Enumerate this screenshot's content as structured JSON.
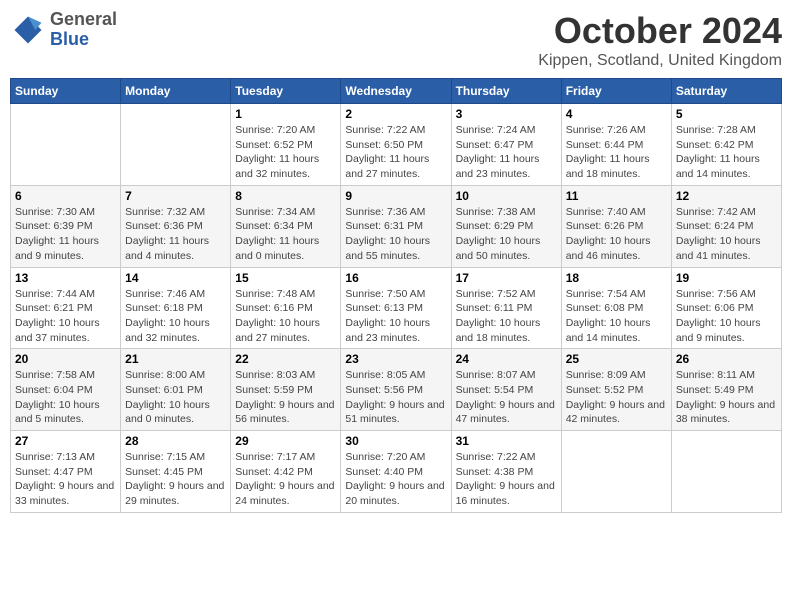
{
  "header": {
    "logo": {
      "general": "General",
      "blue": "Blue"
    },
    "title": "October 2024",
    "location": "Kippen, Scotland, United Kingdom"
  },
  "days_of_week": [
    "Sunday",
    "Monday",
    "Tuesday",
    "Wednesday",
    "Thursday",
    "Friday",
    "Saturday"
  ],
  "weeks": [
    [
      null,
      null,
      {
        "day": "1",
        "sunrise": "Sunrise: 7:20 AM",
        "sunset": "Sunset: 6:52 PM",
        "daylight": "Daylight: 11 hours and 32 minutes."
      },
      {
        "day": "2",
        "sunrise": "Sunrise: 7:22 AM",
        "sunset": "Sunset: 6:50 PM",
        "daylight": "Daylight: 11 hours and 27 minutes."
      },
      {
        "day": "3",
        "sunrise": "Sunrise: 7:24 AM",
        "sunset": "Sunset: 6:47 PM",
        "daylight": "Daylight: 11 hours and 23 minutes."
      },
      {
        "day": "4",
        "sunrise": "Sunrise: 7:26 AM",
        "sunset": "Sunset: 6:44 PM",
        "daylight": "Daylight: 11 hours and 18 minutes."
      },
      {
        "day": "5",
        "sunrise": "Sunrise: 7:28 AM",
        "sunset": "Sunset: 6:42 PM",
        "daylight": "Daylight: 11 hours and 14 minutes."
      }
    ],
    [
      {
        "day": "6",
        "sunrise": "Sunrise: 7:30 AM",
        "sunset": "Sunset: 6:39 PM",
        "daylight": "Daylight: 11 hours and 9 minutes."
      },
      {
        "day": "7",
        "sunrise": "Sunrise: 7:32 AM",
        "sunset": "Sunset: 6:36 PM",
        "daylight": "Daylight: 11 hours and 4 minutes."
      },
      {
        "day": "8",
        "sunrise": "Sunrise: 7:34 AM",
        "sunset": "Sunset: 6:34 PM",
        "daylight": "Daylight: 11 hours and 0 minutes."
      },
      {
        "day": "9",
        "sunrise": "Sunrise: 7:36 AM",
        "sunset": "Sunset: 6:31 PM",
        "daylight": "Daylight: 10 hours and 55 minutes."
      },
      {
        "day": "10",
        "sunrise": "Sunrise: 7:38 AM",
        "sunset": "Sunset: 6:29 PM",
        "daylight": "Daylight: 10 hours and 50 minutes."
      },
      {
        "day": "11",
        "sunrise": "Sunrise: 7:40 AM",
        "sunset": "Sunset: 6:26 PM",
        "daylight": "Daylight: 10 hours and 46 minutes."
      },
      {
        "day": "12",
        "sunrise": "Sunrise: 7:42 AM",
        "sunset": "Sunset: 6:24 PM",
        "daylight": "Daylight: 10 hours and 41 minutes."
      }
    ],
    [
      {
        "day": "13",
        "sunrise": "Sunrise: 7:44 AM",
        "sunset": "Sunset: 6:21 PM",
        "daylight": "Daylight: 10 hours and 37 minutes."
      },
      {
        "day": "14",
        "sunrise": "Sunrise: 7:46 AM",
        "sunset": "Sunset: 6:18 PM",
        "daylight": "Daylight: 10 hours and 32 minutes."
      },
      {
        "day": "15",
        "sunrise": "Sunrise: 7:48 AM",
        "sunset": "Sunset: 6:16 PM",
        "daylight": "Daylight: 10 hours and 27 minutes."
      },
      {
        "day": "16",
        "sunrise": "Sunrise: 7:50 AM",
        "sunset": "Sunset: 6:13 PM",
        "daylight": "Daylight: 10 hours and 23 minutes."
      },
      {
        "day": "17",
        "sunrise": "Sunrise: 7:52 AM",
        "sunset": "Sunset: 6:11 PM",
        "daylight": "Daylight: 10 hours and 18 minutes."
      },
      {
        "day": "18",
        "sunrise": "Sunrise: 7:54 AM",
        "sunset": "Sunset: 6:08 PM",
        "daylight": "Daylight: 10 hours and 14 minutes."
      },
      {
        "day": "19",
        "sunrise": "Sunrise: 7:56 AM",
        "sunset": "Sunset: 6:06 PM",
        "daylight": "Daylight: 10 hours and 9 minutes."
      }
    ],
    [
      {
        "day": "20",
        "sunrise": "Sunrise: 7:58 AM",
        "sunset": "Sunset: 6:04 PM",
        "daylight": "Daylight: 10 hours and 5 minutes."
      },
      {
        "day": "21",
        "sunrise": "Sunrise: 8:00 AM",
        "sunset": "Sunset: 6:01 PM",
        "daylight": "Daylight: 10 hours and 0 minutes."
      },
      {
        "day": "22",
        "sunrise": "Sunrise: 8:03 AM",
        "sunset": "Sunset: 5:59 PM",
        "daylight": "Daylight: 9 hours and 56 minutes."
      },
      {
        "day": "23",
        "sunrise": "Sunrise: 8:05 AM",
        "sunset": "Sunset: 5:56 PM",
        "daylight": "Daylight: 9 hours and 51 minutes."
      },
      {
        "day": "24",
        "sunrise": "Sunrise: 8:07 AM",
        "sunset": "Sunset: 5:54 PM",
        "daylight": "Daylight: 9 hours and 47 minutes."
      },
      {
        "day": "25",
        "sunrise": "Sunrise: 8:09 AM",
        "sunset": "Sunset: 5:52 PM",
        "daylight": "Daylight: 9 hours and 42 minutes."
      },
      {
        "day": "26",
        "sunrise": "Sunrise: 8:11 AM",
        "sunset": "Sunset: 5:49 PM",
        "daylight": "Daylight: 9 hours and 38 minutes."
      }
    ],
    [
      {
        "day": "27",
        "sunrise": "Sunrise: 7:13 AM",
        "sunset": "Sunset: 4:47 PM",
        "daylight": "Daylight: 9 hours and 33 minutes."
      },
      {
        "day": "28",
        "sunrise": "Sunrise: 7:15 AM",
        "sunset": "Sunset: 4:45 PM",
        "daylight": "Daylight: 9 hours and 29 minutes."
      },
      {
        "day": "29",
        "sunrise": "Sunrise: 7:17 AM",
        "sunset": "Sunset: 4:42 PM",
        "daylight": "Daylight: 9 hours and 24 minutes."
      },
      {
        "day": "30",
        "sunrise": "Sunrise: 7:20 AM",
        "sunset": "Sunset: 4:40 PM",
        "daylight": "Daylight: 9 hours and 20 minutes."
      },
      {
        "day": "31",
        "sunrise": "Sunrise: 7:22 AM",
        "sunset": "Sunset: 4:38 PM",
        "daylight": "Daylight: 9 hours and 16 minutes."
      },
      null,
      null
    ]
  ]
}
